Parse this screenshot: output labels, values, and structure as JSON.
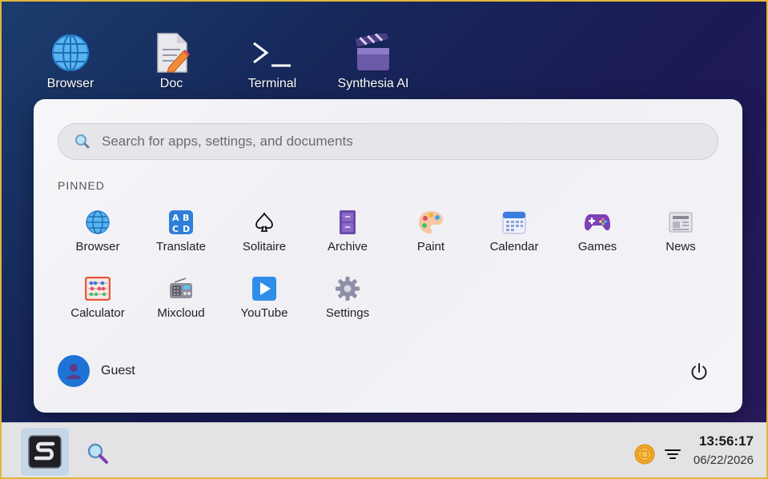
{
  "desktop": {
    "icons": [
      {
        "label": "Browser",
        "icon": "globe-icon"
      },
      {
        "label": "Doc",
        "icon": "document-icon"
      },
      {
        "label": "Terminal",
        "icon": "terminal-icon"
      },
      {
        "label": "Synthesia AI",
        "icon": "clapperboard-icon"
      }
    ]
  },
  "start_menu": {
    "search": {
      "placeholder": "Search for apps, settings, and documents",
      "value": ""
    },
    "pinned_heading": "PINNED",
    "pinned": [
      {
        "label": "Browser",
        "icon": "globe-icon"
      },
      {
        "label": "Translate",
        "icon": "translate-icon"
      },
      {
        "label": "Solitaire",
        "icon": "spade-icon"
      },
      {
        "label": "Archive",
        "icon": "file-cabinet-icon"
      },
      {
        "label": "Paint",
        "icon": "palette-icon"
      },
      {
        "label": "Calendar",
        "icon": "calendar-icon"
      },
      {
        "label": "Games",
        "icon": "gamepad-icon"
      },
      {
        "label": "News",
        "icon": "newspaper-icon"
      },
      {
        "label": "Calculator",
        "icon": "abacus-icon"
      },
      {
        "label": "Mixcloud",
        "icon": "radio-icon"
      },
      {
        "label": "YouTube",
        "icon": "play-icon"
      },
      {
        "label": "Settings",
        "icon": "gear-icon"
      }
    ],
    "user": {
      "name": "Guest"
    }
  },
  "taskbar": {
    "time": "13:56:17",
    "date": "06/22/2026"
  },
  "colors": {
    "accent": "#1e73d6",
    "frame": "#e0b63a"
  }
}
